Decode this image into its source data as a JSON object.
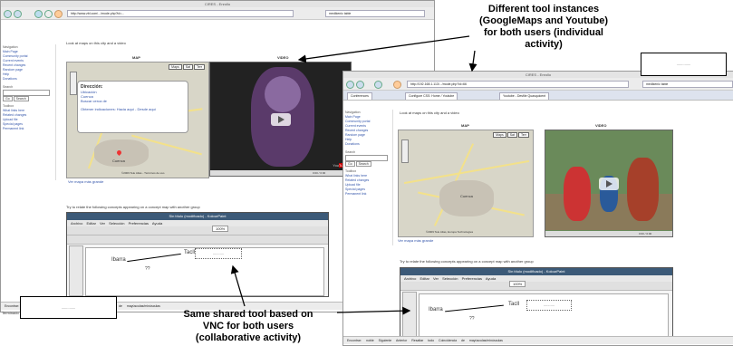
{
  "annotations": {
    "top_right_line1": "Different tool instances",
    "top_right_line2": "(GoogleMaps and Youtube)",
    "top_right_line3": "for both users (individual",
    "top_right_line4": "activity)",
    "bottom_line1": "Same shared tool based on",
    "bottom_line2": "VNC for both users",
    "bottom_line3": "(collaborative activity)"
  },
  "left_window": {
    "title": "CIRES - Enrollo",
    "url": "http://www.zbl.com/.../mode.php?id=...",
    "search_placeholder": "medikenic table",
    "page_heading": "Look at maps on this city and a video",
    "map_label": "MAP",
    "video_label": "VIDEO",
    "map_buttons": [
      "Maps",
      "Sat",
      "Terr"
    ],
    "bubble_title": "Dirección:",
    "bubble_lines": [
      "Ubicación",
      "Cuenca",
      "Buscar cerca de"
    ],
    "bubble_footer": "Obtener indicaciones: Hacia aquí - Desde aquí",
    "map_city": "Cuenca",
    "map_footer": "©2009 Tele Atlas - Términos de uso",
    "map_link": "Ver mapa más grande",
    "video_time": "0:00 / 0:00",
    "instruction": "Try to relate the following concepts appearing on a concept map with another group",
    "vnc_title": "Sin título (modificado) - KolourPaint",
    "vnc_menu": "Archivo  Editar  Ver  Selección  Preferencias  Ayuda",
    "zoom": "100%",
    "canvas_word1": "Ibarra",
    "canvas_word2": "Tacll",
    "canvas_word3": "??",
    "sidebar_heading": "Navigation",
    "sidebar_items": [
      "Main Page",
      "Community portal",
      "Current events",
      "Recent changes",
      "Random page",
      "Help",
      "Donations"
    ],
    "sidebar_search_label": "Search",
    "sidebar_buttons": [
      "Go",
      "Search"
    ],
    "sidebar_tools_label": "Toolbox",
    "sidebar_tools": [
      "What links here",
      "Related changes",
      "Upload file",
      "Special pages",
      "Permanent link"
    ],
    "statusbar": "Encontrar:  noble  Siguiente  Anterior  Resaltar todo  Coincidencia de mayúsculas/minúsculas",
    "statusbar_done": "Terminado"
  },
  "right_window": {
    "title": "CIRES - Enrollo",
    "url": "http://192.168.1.113/.../mode.php?id=66",
    "search_placeholder": "medikenic table",
    "tabs": [
      "Conferences",
      "Configure CSS: Home / Youtube",
      "Youtube - Desfile Quasquicent"
    ],
    "page_heading": "Look at maps on this city and a video",
    "map_label": "MAP",
    "video_label": "VIDEO",
    "map_buttons": [
      "Maps",
      "Sat",
      "Terr"
    ],
    "map_city": "Cuenca",
    "map_footer": "©2009 Tele Atlas, Europa Technologies",
    "map_link": "Ver mapa más grande",
    "video_time": "0:00 / 0:00",
    "instruction": "Try to relate the following concepts appearing on a concept map with another group",
    "vnc_title": "Sin título (modificado) - KolourPaint",
    "vnc_menu": "Archivo  Editar  Ver  Selección  Preferencias  Ayuda",
    "zoom": "100%",
    "canvas_word1": "Ibarra",
    "canvas_word2": "Tacll",
    "canvas_word3": "??",
    "sidebar_heading": "Navigation",
    "sidebar_items": [
      "Main Page",
      "Community portal",
      "Current events",
      "Recent changes",
      "Random page",
      "Help",
      "Donations"
    ],
    "sidebar_search_label": "Search",
    "sidebar_buttons": [
      "Go",
      "Search"
    ],
    "sidebar_tools_label": "Toolbox",
    "sidebar_tools": [
      "What links here",
      "Related changes",
      "Upload file",
      "Special pages",
      "Permanent link"
    ],
    "statusbar": "Encontrar:  noble  Siguiente  Anterior  Resaltar todo  Coincidencia de mayúsculas/minúsculas"
  },
  "box_labels": {
    "top_right": "..............",
    "bottom_left": "..............",
    "canvas_left": "...........",
    "canvas_right": "..........."
  },
  "colors": {
    "vnc_titlebar": "#3c5a78",
    "map_road": "#f3e18a",
    "annotation_text": "#000000"
  }
}
